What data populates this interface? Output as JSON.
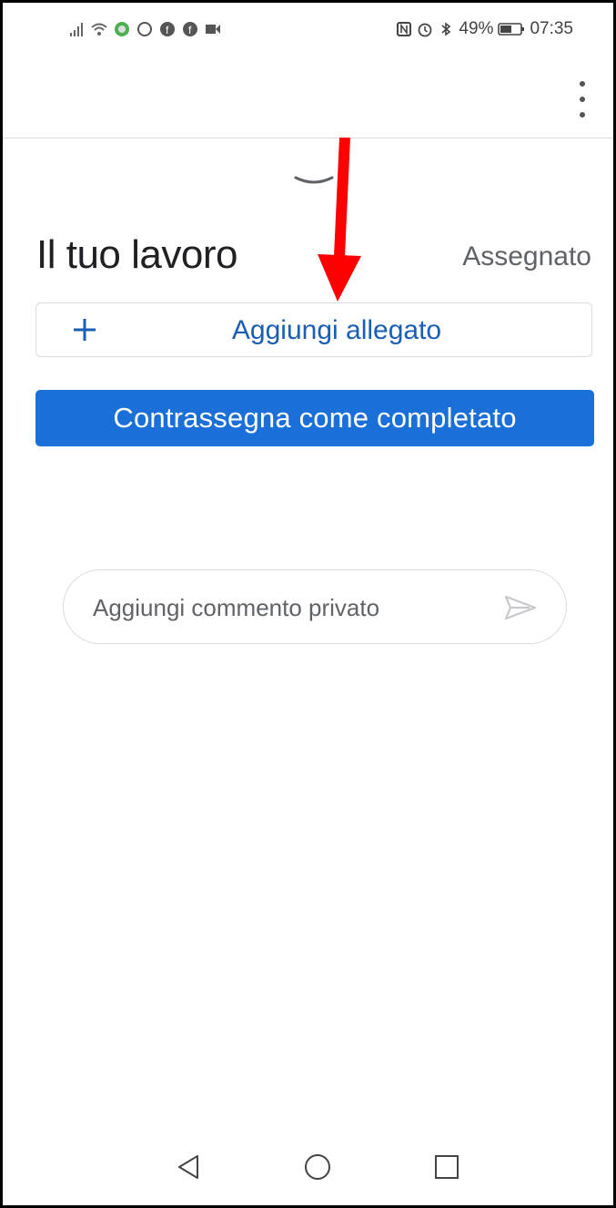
{
  "status_bar": {
    "battery": "49%",
    "time": "07:35",
    "left_icons": [
      "signal-icon",
      "wifi-icon",
      "app-icon",
      "whatsapp-icon",
      "facebook-icon",
      "facebook-icon",
      "video-icon"
    ],
    "right_icons": [
      "nfc-icon",
      "alarm-icon",
      "bluetooth-icon",
      "battery-icon"
    ]
  },
  "app_bar": {
    "menu_icon": "more-vert-icon"
  },
  "work": {
    "title": "Il tuo lavoro",
    "status": "Assegnato",
    "add_attachment_label": "Aggiungi allegato",
    "mark_complete_label": "Contrassegna come completato"
  },
  "comment": {
    "placeholder": "Aggiungi commento privato",
    "value": ""
  },
  "nav_bar": {
    "icons": [
      "back-icon",
      "home-icon",
      "recents-icon"
    ]
  },
  "colors": {
    "primary": "#1a6fd9",
    "link": "#1a5fb4",
    "annotation_arrow": "#ff0000"
  }
}
